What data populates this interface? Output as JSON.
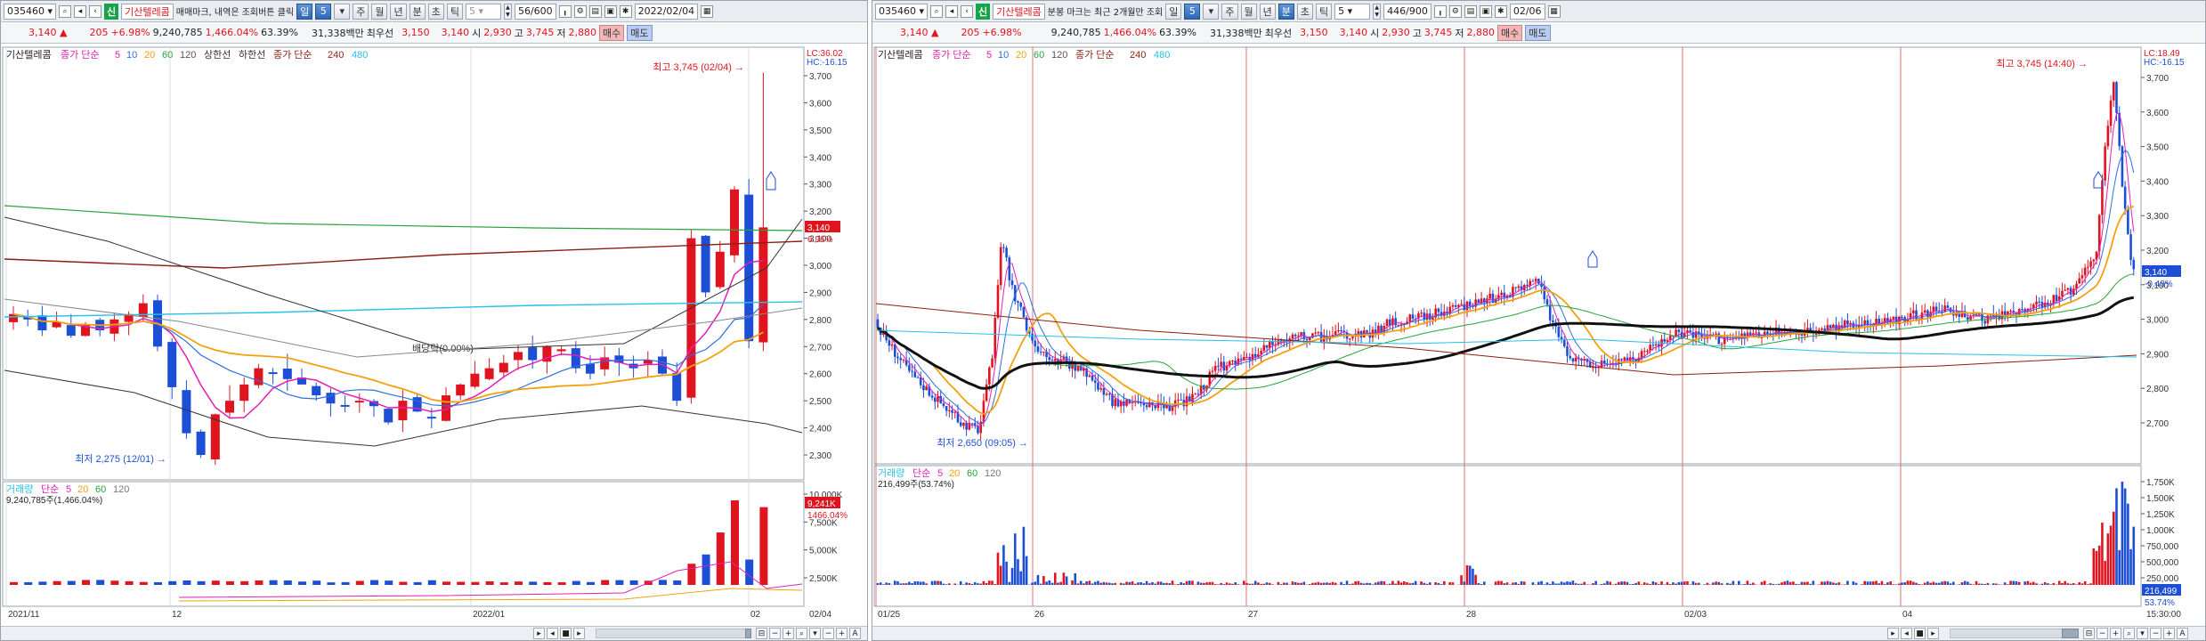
{
  "left": {
    "toolbar": {
      "code": "035460",
      "stock_name": "기산텔레콤",
      "market_badge": "신",
      "memo": "매매마크, 내역은 조회버튼 클릭",
      "periods": [
        "일",
        "5",
        "주",
        "월",
        "년",
        "분",
        "초",
        "틱"
      ],
      "active_period": "일",
      "interval": "5",
      "count": "56/600",
      "date": "2022/02/04"
    },
    "quote": {
      "price": "3,140",
      "change": "205",
      "change_pct": "+6.98%",
      "volume": "9,240,785",
      "vol_pct": "1,466.04%",
      "turnover": "63.39%",
      "amount": "31,338백만",
      "label_best_ask": "최우선",
      "best_ask": "3,150",
      "best_bid": "3,140",
      "open_label": "시",
      "open": "2,930",
      "high_label": "고",
      "high": "3,745",
      "low_label": "저",
      "low": "2,880",
      "buy": "매수",
      "sell": "매도"
    },
    "price_chart": {
      "legend": {
        "name": "기산텔레콤",
        "ma_label": "종가 단순",
        "ma5": "5",
        "ma10": "10",
        "ma20": "20",
        "ma60": "60",
        "ma120": "120",
        "env_up": "상한선",
        "env_down": "하한선",
        "ma2_label": "종가 단순",
        "ma240": "240",
        "ma480": "480"
      },
      "lc": "LC:36.02",
      "hc": "HC:-16.15",
      "max_label": "최고 3,745 (02/04)",
      "min_label": "최저 2,275 (12/01)",
      "dividend_label": "배당락(0.00%)",
      "price_tag": "3,140",
      "pct_tag": "6.96%",
      "y_ticks": [
        "3,700",
        "3,600",
        "3,500",
        "3,400",
        "3,300",
        "3,200",
        "3,100",
        "3,000",
        "2,900",
        "2,800",
        "2,700",
        "2,600",
        "2,500",
        "2,400",
        "2,300"
      ]
    },
    "volume_chart": {
      "legend": {
        "label": "거래량",
        "ma_label": "단순",
        "v5": "5",
        "v20": "20",
        "v60": "60",
        "v120": "120"
      },
      "sub": "9,240,785주(1,466.04%)",
      "y_ticks": [
        "10,000K",
        "7,500K",
        "5,000K",
        "2,500K"
      ],
      "vol_tag": "9,241K",
      "pct_tag": "1466.04%"
    },
    "x_ticks": [
      "2021/11",
      "12",
      "2022/01",
      "02"
    ],
    "x_end": "02/04"
  },
  "right": {
    "toolbar": {
      "code": "035460",
      "stock_name": "기산텔레콤",
      "market_badge": "신",
      "memo": "분봉 마크는 최근 2개월만 조회",
      "periods": [
        "일",
        "5",
        "주",
        "월",
        "년",
        "분",
        "초",
        "틱"
      ],
      "active_period": "분",
      "interval": "5",
      "count": "446/900",
      "date": "02/06"
    },
    "quote": {
      "price": "3,140",
      "change": "205",
      "change_pct": "+6.98%",
      "volume": "9,240,785",
      "vol_pct": "1,466.04%",
      "turnover": "63.39%",
      "amount": "31,338백만",
      "label_best_ask": "최우선",
      "best_ask": "3,150",
      "best_bid": "3,140",
      "open_label": "시",
      "open": "2,930",
      "high_label": "고",
      "high": "3,745",
      "low_label": "저",
      "low": "2,880",
      "buy": "매수",
      "sell": "매도"
    },
    "price_chart": {
      "legend": {
        "name": "기산텔레콤",
        "ma_label": "종가 단순",
        "ma5": "5",
        "ma10": "10",
        "ma20": "20",
        "ma60": "60",
        "ma120": "120",
        "ma2_label": "종가 단순",
        "ma240": "240",
        "ma480": "480"
      },
      "lc": "LC:18.49",
      "hc": "HC:-16.15",
      "max_label": "최고 3,745 (14:40)",
      "min_label": "최저 2,650 (09:05)",
      "price_tag": "3,140",
      "pct_tag": "-0.48%",
      "y_ticks": [
        "3,700",
        "3,600",
        "3,500",
        "3,400",
        "3,300",
        "3,200",
        "3,100",
        "3,000",
        "2,900",
        "2,800",
        "2,700"
      ]
    },
    "volume_chart": {
      "legend": {
        "label": "거래량",
        "ma_label": "단순",
        "v5": "5",
        "v20": "20",
        "v60": "60",
        "v120": "120"
      },
      "sub": "216,499주(53.74%)",
      "y_ticks": [
        "1,750K",
        "1,500K",
        "1,250K",
        "1,000K",
        "750,000",
        "500,000",
        "250,000"
      ],
      "vol_tag": "216,499",
      "pct_tag": "53.74%"
    },
    "x_ticks": [
      "01/25",
      "26",
      "27",
      "28",
      "02/03",
      "04"
    ],
    "x_end": "15:30:00"
  },
  "colors": {
    "up": "#e0141e",
    "down": "#1d4fd6",
    "ma5": "#e21fb5",
    "ma10": "#2e6fe0",
    "ma20": "#f2a10e",
    "ma60": "#23a53a",
    "ma120": "#777777",
    "ma240": "#8a1e10",
    "ma480": "#27c0e8"
  }
}
